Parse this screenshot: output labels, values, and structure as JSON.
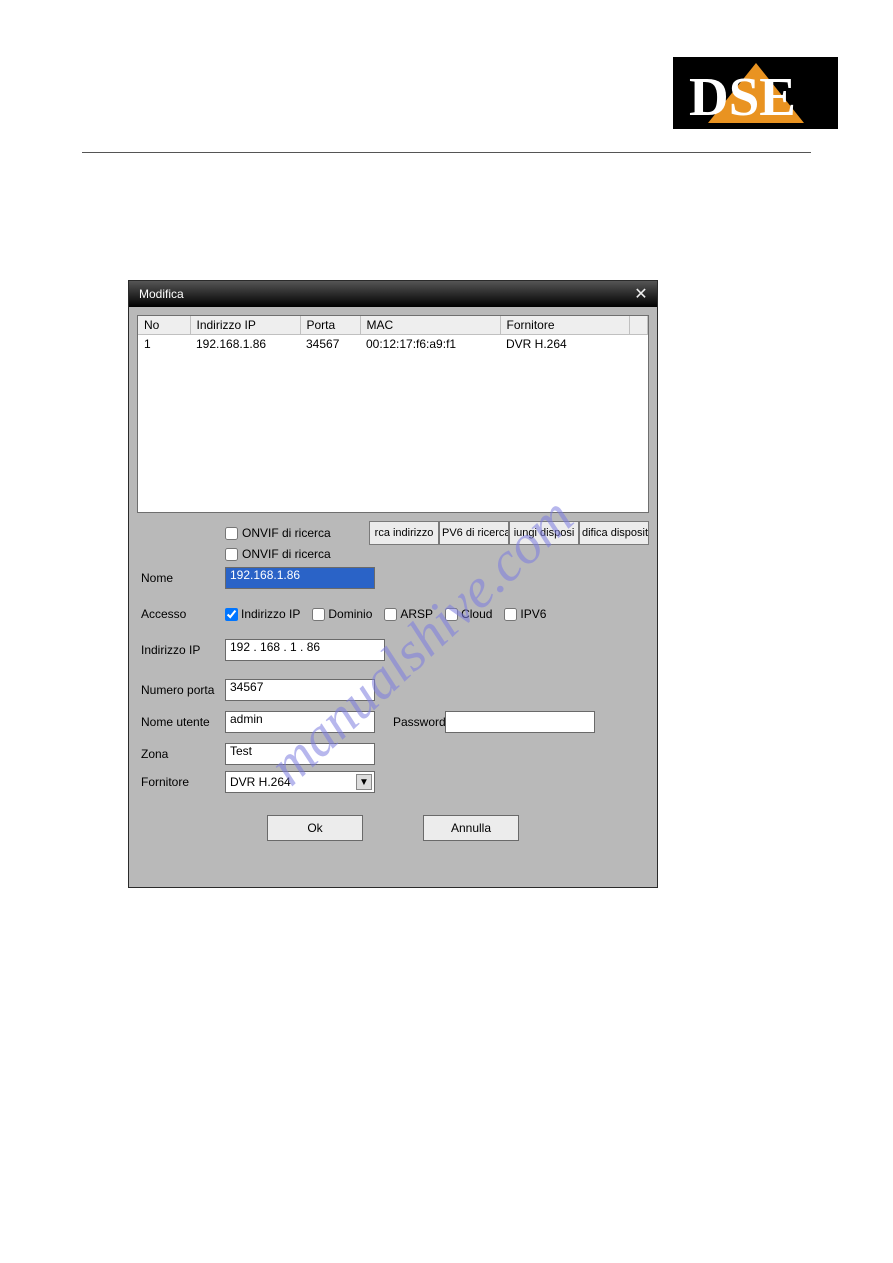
{
  "logo": {
    "text": "DSE"
  },
  "watermark": {
    "text": "manualshive.com"
  },
  "dialog": {
    "title": "Modifica",
    "table": {
      "headers": {
        "no": "No",
        "ip": "Indirizzo IP",
        "port": "Porta",
        "mac": "MAC",
        "vendor": "Fornitore"
      },
      "rows": [
        {
          "no": "1",
          "ip": "192.168.1.86",
          "port": "34567",
          "mac": "00:12:17:f6:a9:f1",
          "vendor": "DVR H.264"
        }
      ]
    },
    "search_row": {
      "check1_label": "ONVIF di ricerca",
      "check2_label": "ONVIF di ricerca",
      "buttons": [
        "rca indirizzo",
        "PV6 di ricerca",
        "iungi disposi",
        "difica disposit"
      ]
    },
    "form": {
      "nome_label": "Nome",
      "nome_value": "192.168.1.86",
      "accesso_label": "Accesso",
      "access_options": {
        "ip": "Indirizzo IP",
        "dominio": "Dominio",
        "arsp": "ARSP",
        "cloud": "Cloud",
        "ipv6": "IPV6"
      },
      "access_checked": "ip",
      "indirizzo_ip_label": "Indirizzo IP",
      "indirizzo_ip_value": "192 . 168 .   1   .  86",
      "numero_porta_label": "Numero porta",
      "numero_porta_value": "34567",
      "nome_utente_label": "Nome utente",
      "nome_utente_value": "admin",
      "password_label": "Password",
      "password_value": "",
      "zona_label": "Zona",
      "zona_value": "Test",
      "fornitore_label": "Fornitore",
      "fornitore_value": "DVR H.264"
    },
    "ok_label": "Ok",
    "cancel_label": "Annulla"
  }
}
